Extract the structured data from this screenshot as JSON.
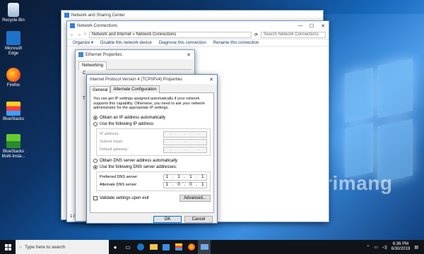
{
  "desktop": {
    "icons": [
      {
        "label": "Recycle Bin"
      },
      {
        "label": "Microsoft Edge"
      },
      {
        "label": "Firefox"
      },
      {
        "label": "BlueStacks"
      },
      {
        "label": "BlueStacks Multi-Insta..."
      }
    ],
    "watermark": "uantrimang"
  },
  "network_sharing_center": {
    "title": "Network and Sharing Center"
  },
  "network_connections": {
    "title": "Network Connections",
    "breadcrumb": [
      "Network and Internet",
      "Network Connections"
    ],
    "search_placeholder": "Search Network Connections",
    "toolbar": [
      "Organize ▾",
      "Disable this network device",
      "Diagnose this connection",
      "Rename this connection"
    ],
    "status": "1 item"
  },
  "ethernet_properties": {
    "title": "Ethernet Properties",
    "tab": "Networking",
    "partial_label_1": "C",
    "partial_label_2": "T"
  },
  "ipv4": {
    "title": "Internet Protocol Version 4 (TCP/IPv4) Properties",
    "tabs": [
      "General",
      "Alternate Configuration"
    ],
    "description": "You can get IP settings assigned automatically if your network supports this capability. Otherwise, you need to ask your network administrator for the appropriate IP settings.",
    "obtain_ip_auto": "Obtain an IP address automatically",
    "use_following_ip": "Use the following IP address:",
    "ip_address_label": "IP address:",
    "subnet_mask_label": "Subnet mask:",
    "default_gateway_label": "Default gateway:",
    "obtain_dns_auto": "Obtain DNS server address automatically",
    "use_following_dns": "Use the following DNS server addresses:",
    "preferred_dns_label": "Preferred DNS server:",
    "preferred_dns": [
      "1",
      "1",
      "1",
      "1"
    ],
    "alternate_dns_label": "Alternate DNS server:",
    "alternate_dns": [
      "1",
      "0",
      "0",
      "1"
    ],
    "validate_label": "Validate settings upon exit",
    "advanced_button": "Advanced...",
    "ok_button": "OK",
    "cancel_button": "Cancel",
    "selected_ip_mode": "auto",
    "selected_dns_mode": "manual"
  },
  "taskbar": {
    "search_placeholder": "Type here to search",
    "time": "6:36 PM",
    "date": "6/30/2019"
  },
  "colors": {
    "accent": "#0078d7",
    "taskbar": "#101418"
  }
}
